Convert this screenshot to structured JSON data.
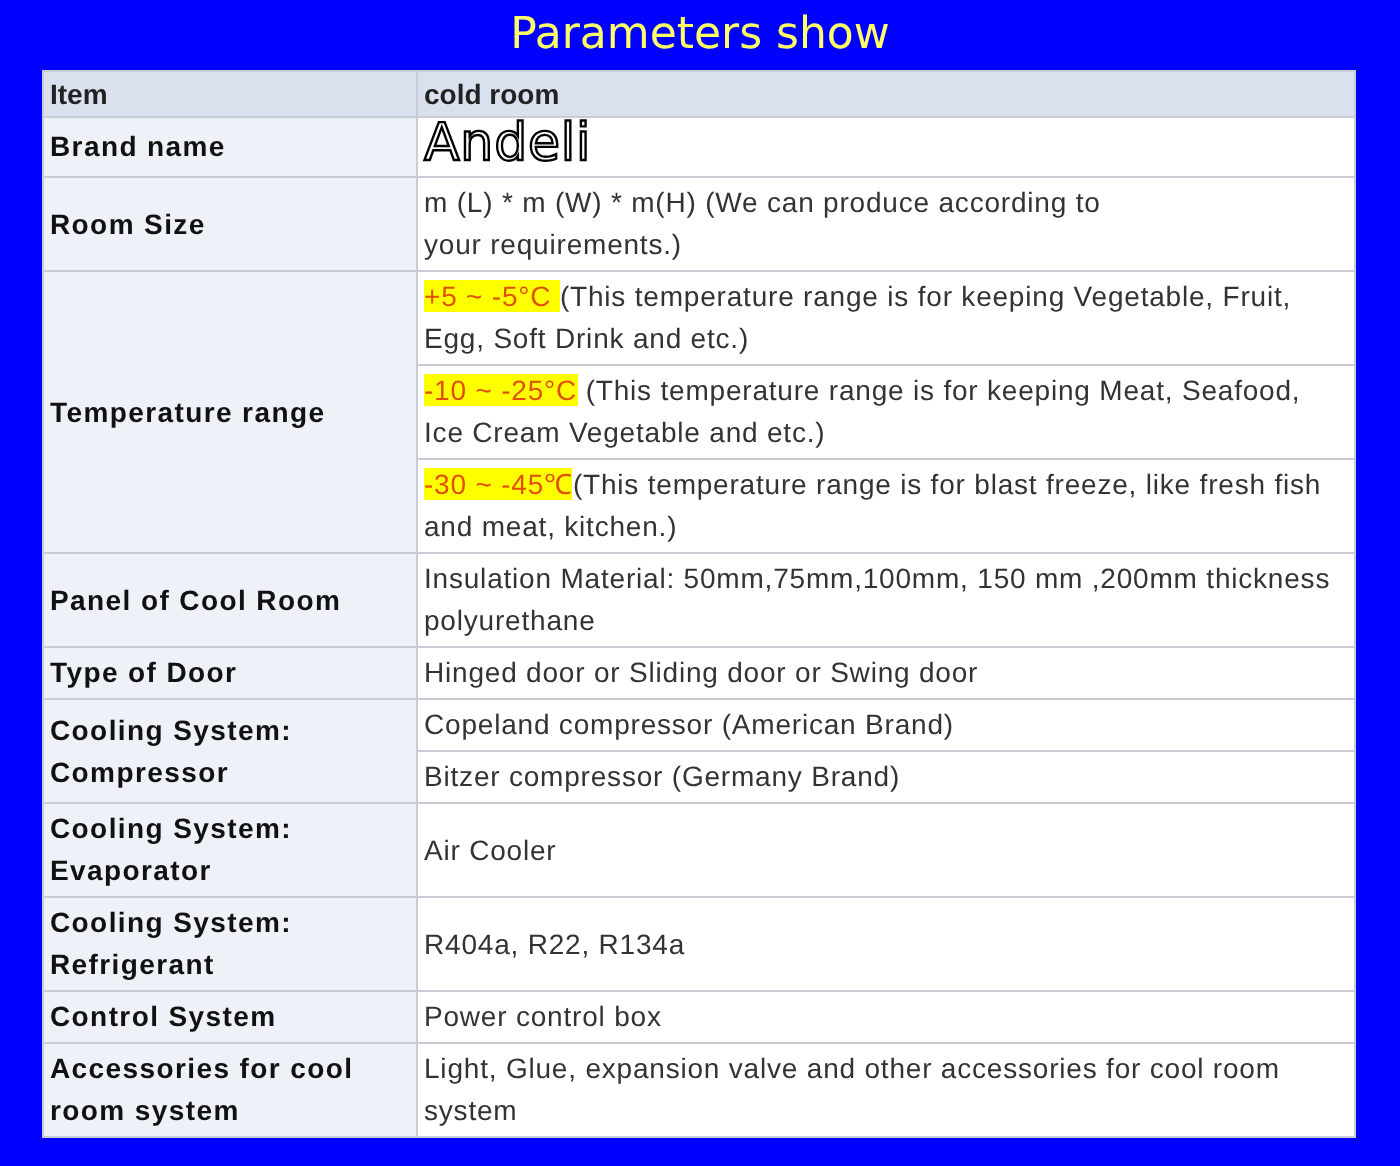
{
  "title": "Parameters show",
  "table": {
    "columns": [
      "Item",
      "cold room"
    ],
    "rows": [
      {
        "label": "Brand name",
        "values": [
          {
            "kind": "brand",
            "text": "Andeli"
          }
        ]
      },
      {
        "label": "Room Size",
        "values": [
          {
            "kind": "plain",
            "text": "m (L) * m (W) * m(H) (We can produce according to\nyour requirements.)"
          }
        ]
      },
      {
        "label": "Temperature range",
        "values": [
          {
            "kind": "range",
            "range": "+5 ~ -5°C ",
            "text": "(This temperature range is for keeping Vegetable, Fruit, Egg, Soft Drink and etc.)"
          },
          {
            "kind": "range",
            "range": "-10 ~ -25°C",
            "text": " (This temperature range is for keeping Meat, Seafood, Ice Cream Vegetable and etc.)"
          },
          {
            "kind": "range",
            "range": "-30 ~ -45℃",
            "text": "(This temperature range is for blast freeze, like fresh fish and meat, kitchen.)"
          }
        ]
      },
      {
        "label": "Panel of Cool Room",
        "values": [
          {
            "kind": "plain",
            "text": "Insulation Material: 50mm,75mm,100mm, 150 mm ,200mm thickness polyurethane"
          }
        ]
      },
      {
        "label": "Type of Door",
        "values": [
          {
            "kind": "plain",
            "text": "Hinged door or Sliding door or Swing door"
          }
        ]
      },
      {
        "label": "Cooling System:\nCompressor",
        "values": [
          {
            "kind": "plain",
            "text": "Copeland compressor (American Brand)"
          },
          {
            "kind": "plain",
            "text": "Bitzer compressor (Germany Brand)"
          }
        ]
      },
      {
        "label": "Cooling System:\nEvaporator",
        "values": [
          {
            "kind": "plain",
            "text": "Air Cooler"
          }
        ]
      },
      {
        "label": "Cooling System:\nRefrigerant",
        "values": [
          {
            "kind": "plain",
            "text": "R404a, R22, R134a"
          }
        ]
      },
      {
        "label": "Control System",
        "values": [
          {
            "kind": "plain",
            "text": "Power control box"
          }
        ]
      },
      {
        "label": "Accessories for cool room system",
        "values": [
          {
            "kind": "plain",
            "text": "Light, Glue, expansion valve and other accessories for cool room system"
          }
        ]
      }
    ]
  }
}
